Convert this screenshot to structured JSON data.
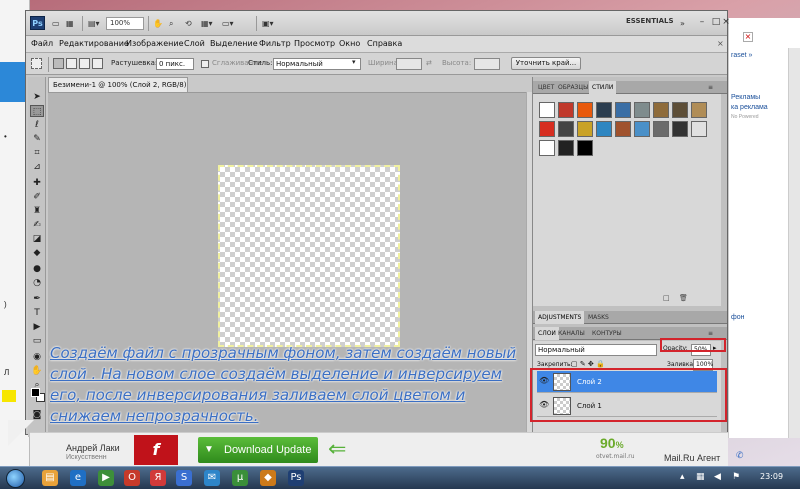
{
  "app": {
    "logo": "Ps",
    "zoom": "100%",
    "workspace": "ESSENTIALS",
    "icons": [
      "layout-icon",
      "hand-icon",
      "zoom-icon",
      "rotate-icon",
      "grid-icon",
      "arrange-icon"
    ]
  },
  "menu": [
    "Файл",
    "Редактирование",
    "Изображение",
    "Слой",
    "Выделение",
    "Фильтр",
    "Просмотр",
    "Окно",
    "Справка"
  ],
  "options": {
    "feather_label": "Растушевка:",
    "feather_value": "0 пикс.",
    "antialias_label": "Сглаживание",
    "style_label": "Стиль:",
    "style_value": "Нормальный",
    "width_label": "Ширина:",
    "height_label": "Высота:",
    "refine_button": "Уточнить край..."
  },
  "document": {
    "tab_title": "Безимени-1 @ 100% (Слой 2, RGB/8) *"
  },
  "panels": {
    "top_tabs": [
      "ЦВЕТ",
      "ОБРАЗЦЫ",
      "СТИЛИ"
    ],
    "style_colors": [
      "#ffffff",
      "#c0392b",
      "#e8590c",
      "#2c3e50",
      "#3a6ea5",
      "#7f8c8d",
      "#8e6b3a",
      "#5d4e37",
      "#b08d57",
      "#d62d20",
      "#444444",
      "#c9a227",
      "#2e86c1",
      "#a0522d",
      "#4a90c8",
      "#6b6b6b",
      "#333333",
      "#e0e0e0",
      "#ffffff",
      "#222222",
      "#000000"
    ],
    "adj_tabs": [
      "ADJUSTMENTS",
      "MASKS"
    ],
    "layer_tabs": [
      "СЛОИ",
      "КАНАЛЫ",
      "КОНТУРЫ"
    ],
    "blend_mode": "Нормальный",
    "opacity_label": "Opacity:",
    "opacity_value": "50%",
    "lock_label": "Закрепить:",
    "fill_label": "Заливка:",
    "fill_value": "100%",
    "layers": [
      {
        "name": "Слой 2",
        "selected": true
      },
      {
        "name": "Слой 1",
        "selected": false
      }
    ]
  },
  "caption": "Создаём файл с прозрачным фоном, затем создаём новый слой . На новом слое создаём выделение и инверсируем его, после инверсирования заливаем слой цветом и снижаем непрозрачность.",
  "background_page": {
    "right_texts": [
      "raset »",
      "Рекламы",
      "ка реклама",
      "No Powered",
      "фон"
    ]
  },
  "ad": {
    "name": "Андрей Лаки",
    "subtitle": "Искусственн",
    "flash_letter": "f",
    "download_label": "Download Update",
    "percent": "90",
    "percent_unit": "%",
    "percent_sub": "otvet.mail.ru",
    "mailru_label": "Mail.Ru Агент"
  },
  "taskbar": {
    "clock": "23:09"
  }
}
